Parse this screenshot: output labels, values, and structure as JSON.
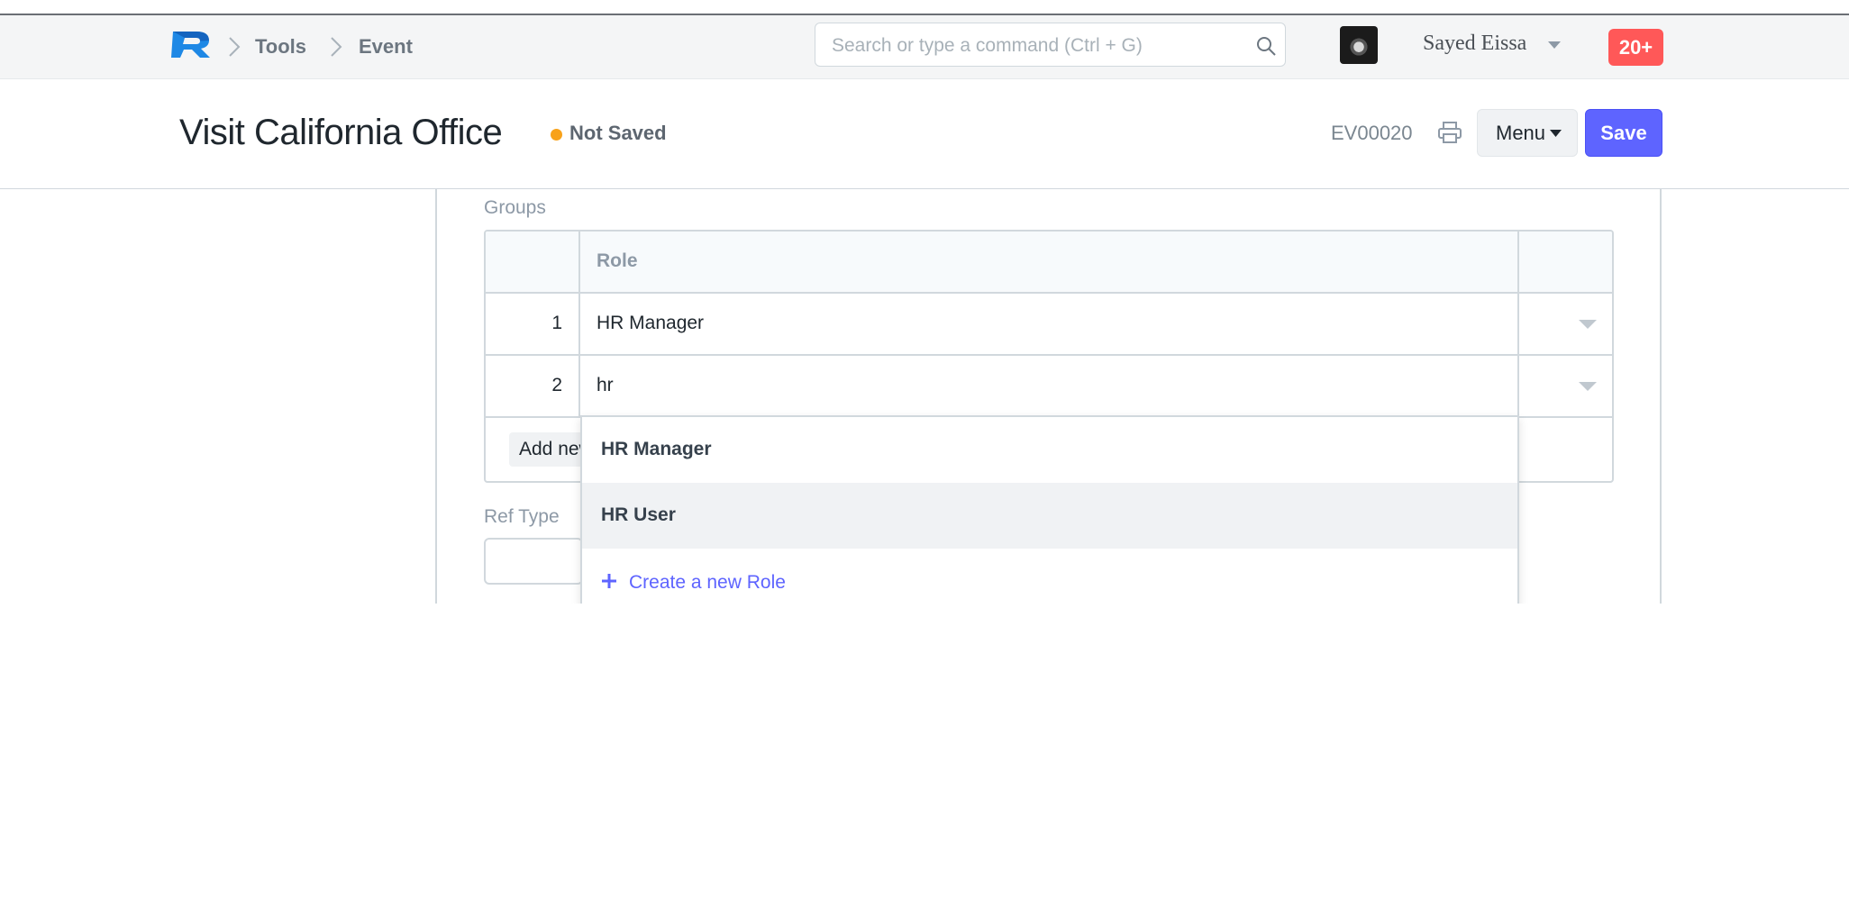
{
  "navbar": {
    "logo_letter": "R",
    "breadcrumbs": [
      "Tools",
      "Event"
    ],
    "search": {
      "placeholder": "Search or type a command (Ctrl + G)",
      "value": ""
    },
    "user": {
      "name": "Sayed Eissa"
    },
    "notifications": {
      "count_label": "20+"
    }
  },
  "page": {
    "title": "Visit California Office",
    "status": "Not Saved",
    "doc_id": "EV00020",
    "menu_label": "Menu",
    "save_label": "Save"
  },
  "form": {
    "groups_label": "Groups",
    "table": {
      "columns": [
        "Role"
      ],
      "rows": [
        {
          "index": "1",
          "role": "HR Manager"
        },
        {
          "index": "2",
          "role": "hr"
        }
      ],
      "add_row_label": "Add new row"
    },
    "ref_type_label": "Ref Type"
  },
  "autocomplete": {
    "items": [
      "HR Manager",
      "HR User"
    ],
    "create_label": "Create a new Role"
  },
  "colors": {
    "primary": "#5e64ff",
    "notification": "#ff5858",
    "not_saved_dot": "#f8a21a"
  }
}
